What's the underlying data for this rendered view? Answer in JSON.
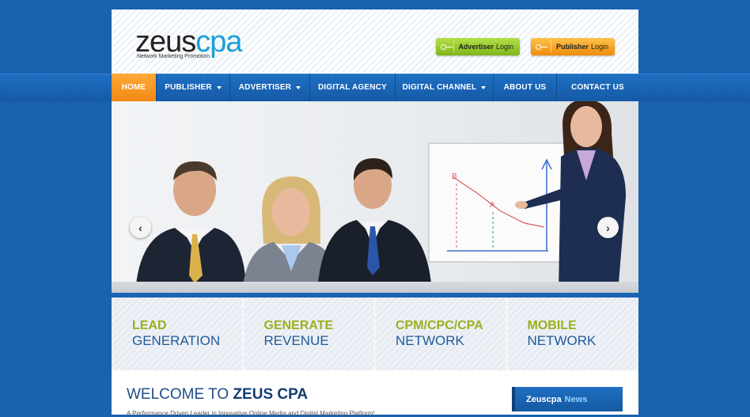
{
  "brand": {
    "logo_main": "zeus",
    "logo_accent": "cpa",
    "tagline": "Network Marketing Promotion"
  },
  "login": {
    "advertiser_bold": "Advertiser",
    "advertiser_light": "Login",
    "publisher_bold": "Publisher",
    "publisher_light": "Login"
  },
  "nav": {
    "items": [
      {
        "label": "HOME",
        "active": true
      },
      {
        "label": "PUBLISHER",
        "dropdown": true
      },
      {
        "label": "ADVERTISER",
        "dropdown": true
      },
      {
        "label": "DIGITAL AGENCY"
      },
      {
        "label": "DIGITAL CHANNEL",
        "dropdown": true
      },
      {
        "label": "ABOUT US"
      },
      {
        "label": "CONTACT US"
      }
    ]
  },
  "slider": {
    "prev_icon": "chevron-left-icon",
    "next_icon": "chevron-right-icon",
    "chart_label_b": "B",
    "chart_label_a": "A"
  },
  "features": [
    {
      "line1": "LEAD",
      "line2": "GENERATION"
    },
    {
      "line1": "GENERATE",
      "line2": "REVENUE"
    },
    {
      "line1": "CPM/CPC/CPA",
      "line2": "NETWORK"
    },
    {
      "line1": "MOBILE",
      "line2": "NETWORK"
    }
  ],
  "welcome": {
    "prefix": "WELCOME TO",
    "brand": "ZEUS CPA",
    "subtitle": "A Performance Driven Leader in Innovative Online Media and Digital Marketing Platform!"
  },
  "news": {
    "title": "Zeuscpa",
    "title_accent": "News"
  },
  "colors": {
    "background": "#1a62ae",
    "nav_active": "#f08a12",
    "feature_title": "#9bb020",
    "feature_subtitle": "#1f5a9a"
  }
}
